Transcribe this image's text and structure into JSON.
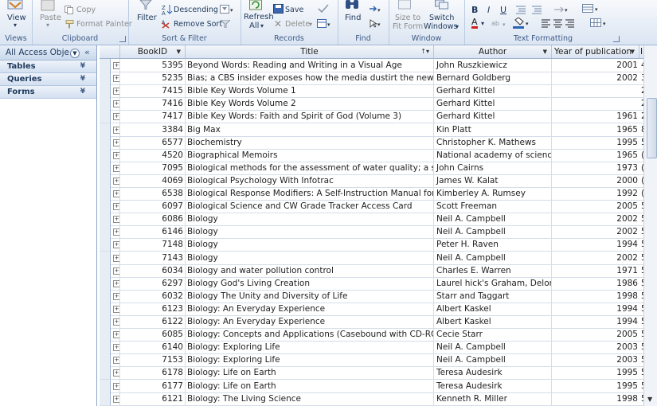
{
  "ribbon": {
    "views": {
      "view_label": "View",
      "group": "Views"
    },
    "clipboard": {
      "paste": "Paste",
      "copy": "Copy",
      "format_painter": "Format Painter",
      "group": "Clipboard"
    },
    "sort_filter": {
      "filter": "Filter",
      "descending": "Descending",
      "remove_sort": "Remove Sort",
      "group": "Sort & Filter"
    },
    "records": {
      "refresh": "Refresh",
      "refresh_all": "All",
      "save": "Save",
      "delete": "Delete",
      "group": "Records"
    },
    "find": {
      "find": "Find",
      "group": "Find"
    },
    "window": {
      "size_to_fit": "Size to",
      "size_to_fit2": "Fit Form",
      "switch": "Switch",
      "switch2": "Windows",
      "group": "Window"
    },
    "text_formatting": {
      "bold": "B",
      "italic": "I",
      "underline": "U",
      "font_color": "A",
      "group": "Text Formatting"
    }
  },
  "nav": {
    "header": "All Access Obje...",
    "groups": [
      "Tables",
      "Queries",
      "Forms"
    ]
  },
  "grid": {
    "columns": {
      "bookid": "BookID",
      "title": "Title",
      "author": "Author",
      "year": "Year of publication",
      "extra": "I"
    },
    "rows": [
      {
        "id": "5395",
        "title": "Beyond Words: Reading and Writing in a Visual Age",
        "author": "John Ruszkiewicz",
        "year": "2001",
        "tail": "4"
      },
      {
        "id": "5235",
        "title": "Bias; a CBS insider exposes how the media dustirt the news",
        "author": "Bernard Goldberg",
        "year": "2002",
        "tail": "3"
      },
      {
        "id": "7415",
        "title": "Bible Key Words Volume 1",
        "author": "Gerhard Kittel",
        "year": "",
        "tail": "2"
      },
      {
        "id": "7416",
        "title": "Bible Key Words Volume 2",
        "author": "Gerhard Kittel",
        "year": "",
        "tail": "2"
      },
      {
        "id": "7417",
        "title": "Bible Key Words: Faith and Spirit of God (Volume 3)",
        "author": "Gerhard Kittel",
        "year": "1961",
        "tail": "2"
      },
      {
        "id": "3384",
        "title": "Big Max",
        "author": "Kin Platt",
        "year": "1965",
        "tail": "8"
      },
      {
        "id": "6577",
        "title": "Biochemistry",
        "author": "Christopher K. Mathews",
        "year": "1995",
        "tail": "5"
      },
      {
        "id": "4520",
        "title": "Biographical Memoirs",
        "author": "National academy of sciences",
        "year": "1965",
        "tail": "("
      },
      {
        "id": "7095",
        "title": "Biological methods for the assessment of water quality; a symp",
        "author": "John Cairns",
        "year": "1973",
        "tail": "("
      },
      {
        "id": "4069",
        "title": "Biological Psychology With Infotrac",
        "author": "James W. Kalat",
        "year": "2000",
        "tail": "("
      },
      {
        "id": "6538",
        "title": "Biological Response Modifiers: A Self-Instruction Manual for H",
        "author": "Kimberley A. Rumsey",
        "year": "1992",
        "tail": "("
      },
      {
        "id": "6097",
        "title": "Biological Science and CW Grade Tracker Access Card",
        "author": "Scott Freeman",
        "year": "2005",
        "tail": "5"
      },
      {
        "id": "6086",
        "title": "Biology",
        "author": "Neil A. Campbell",
        "year": "2002",
        "tail": "5"
      },
      {
        "id": "6146",
        "title": "Biology",
        "author": "Neil A. Campbell",
        "year": "2002",
        "tail": "5"
      },
      {
        "id": "7148",
        "title": "Biology",
        "author": "Peter H. Raven",
        "year": "1994",
        "tail": "5"
      },
      {
        "id": "7143",
        "title": "Biology",
        "author": "Neil A. Campbell",
        "year": "2002",
        "tail": "5"
      },
      {
        "id": "6034",
        "title": "Biology and water pollution control",
        "author": "Charles E. Warren",
        "year": "1971",
        "tail": "5"
      },
      {
        "id": "6297",
        "title": "Biology God's Living Creation",
        "author": "Laurel hick's Graham, Delores",
        "year": "1986",
        "tail": "5"
      },
      {
        "id": "6032",
        "title": "Biology The Unity and Diversity of Life",
        "author": "Starr and Taggart",
        "year": "1998",
        "tail": "5"
      },
      {
        "id": "6123",
        "title": "Biology: An Everyday Experience",
        "author": "Albert Kaskel",
        "year": "1994",
        "tail": "5"
      },
      {
        "id": "6122",
        "title": "Biology: An Everyday Experience",
        "author": "Albert Kaskel",
        "year": "1994",
        "tail": "5"
      },
      {
        "id": "6085",
        "title": "Biology: Concepts and Applications (Casebound with CD-ROM,",
        "author": "Cecie Starr",
        "year": "2005",
        "tail": "5"
      },
      {
        "id": "6140",
        "title": "Biology: Exploring Life",
        "author": "Neil A. Campbell",
        "year": "2003",
        "tail": "5"
      },
      {
        "id": "7153",
        "title": "Biology: Exploring Life",
        "author": "Neil A. Campbell",
        "year": "2003",
        "tail": "5"
      },
      {
        "id": "6178",
        "title": "Biology: Life on Earth",
        "author": "Teresa Audesirk",
        "year": "1995",
        "tail": "5"
      },
      {
        "id": "6177",
        "title": "Biology: Life on Earth",
        "author": "Teresa Audesirk",
        "year": "1995",
        "tail": "5"
      },
      {
        "id": "6121",
        "title": "Biology: The Living Science",
        "author": "Kenneth R. Miller",
        "year": "1998",
        "tail": "5"
      }
    ]
  }
}
